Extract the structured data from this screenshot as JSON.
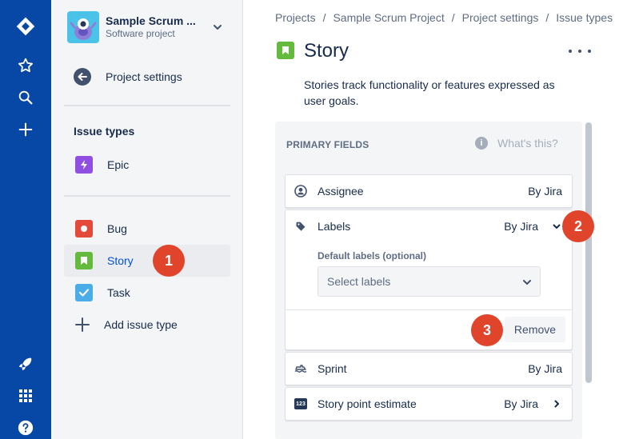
{
  "global_nav": {
    "icons": [
      "jira-logo-icon",
      "star-icon",
      "search-icon",
      "plus-icon",
      "rocket-icon",
      "app-grid-icon",
      "help-icon"
    ]
  },
  "sidebar": {
    "project": {
      "name": "Sample Scrum ...",
      "type": "Software project"
    },
    "back_label": "Project settings",
    "section_title": "Issue types",
    "top_types": [
      {
        "label": "Epic",
        "color": "#904ee2"
      }
    ],
    "types": [
      {
        "label": "Bug",
        "color": "#e5493a"
      },
      {
        "label": "Story",
        "color": "#63ba3c"
      },
      {
        "label": "Task",
        "color": "#4bade8"
      }
    ],
    "add_label": "Add issue type"
  },
  "markers": [
    "1",
    "2",
    "3"
  ],
  "breadcrumbs": [
    "Projects",
    "Sample Scrum Project",
    "Project settings",
    "Issue types"
  ],
  "breadcrumb_sep": "/",
  "page": {
    "title": "Story",
    "description": "Stories track functionality or features expressed as user goals."
  },
  "panel": {
    "title": "PRIMARY FIELDS",
    "help": "What's this?",
    "fields": [
      {
        "name": "Assignee",
        "source": "By Jira"
      },
      {
        "name": "Labels",
        "source": "By Jira"
      },
      {
        "name": "Sprint",
        "source": "By Jira"
      },
      {
        "name": "Story point estimate",
        "source": "By Jira",
        "icon_text": "123"
      }
    ],
    "labels_expanded": {
      "sub_label": "Default labels (optional)",
      "placeholder": "Select labels",
      "remove_label": "Remove"
    }
  }
}
